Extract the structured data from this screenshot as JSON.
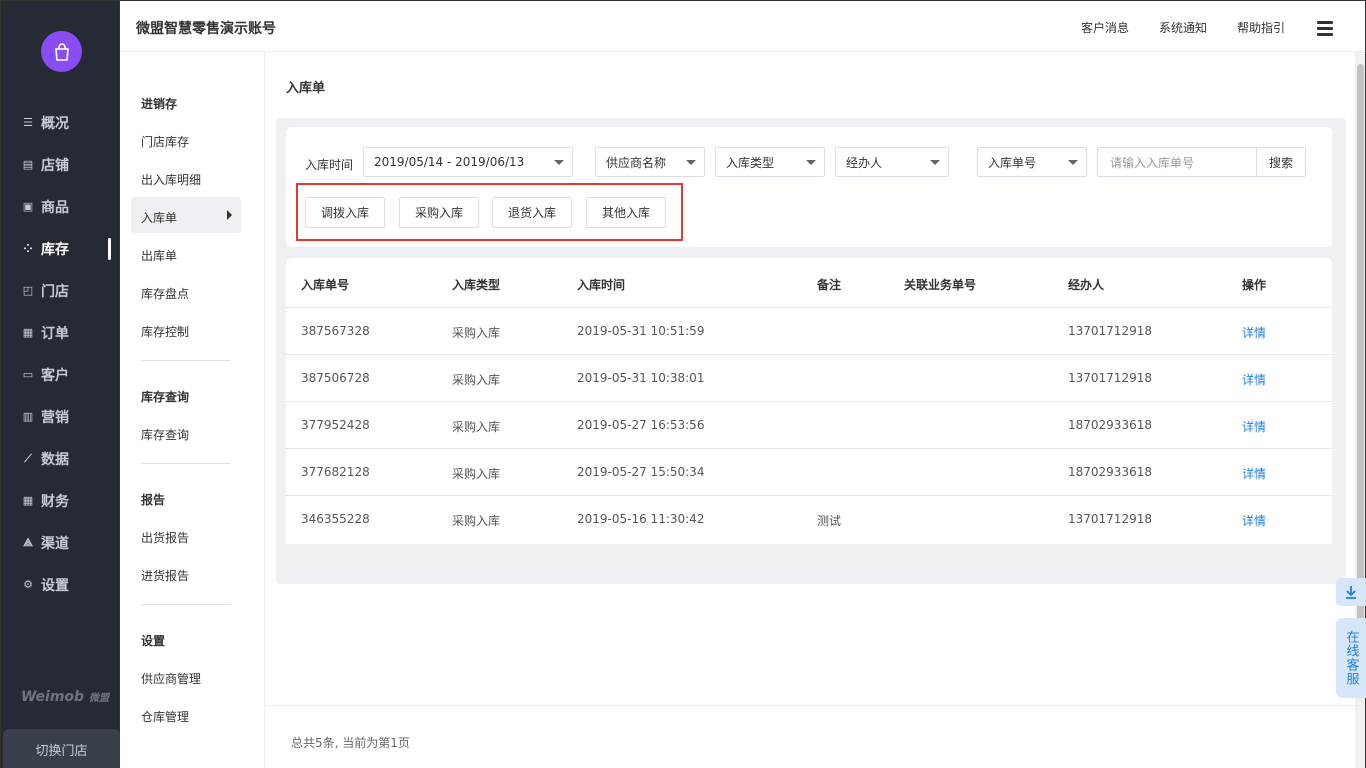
{
  "nav": {
    "items": [
      {
        "label": "概况",
        "icon": "list-icon"
      },
      {
        "label": "店铺",
        "icon": "store-icon"
      },
      {
        "label": "商品",
        "icon": "goods-icon"
      },
      {
        "label": "库存",
        "icon": "inventory-icon",
        "active": true
      },
      {
        "label": "门店",
        "icon": "shop-icon"
      },
      {
        "label": "订单",
        "icon": "order-icon"
      },
      {
        "label": "客户",
        "icon": "customer-icon"
      },
      {
        "label": "营销",
        "icon": "marketing-icon"
      },
      {
        "label": "数据",
        "icon": "data-icon"
      },
      {
        "label": "财务",
        "icon": "finance-icon"
      },
      {
        "label": "渠道",
        "icon": "channel-icon"
      },
      {
        "label": "设置",
        "icon": "settings-icon"
      }
    ],
    "brand": "Weimob",
    "brand_cn": "微盟",
    "switch_store": "切换门店"
  },
  "header": {
    "title": "微盟智慧零售演示账号",
    "links": [
      "客户消息",
      "系统通知",
      "帮助指引"
    ]
  },
  "subnav": {
    "sections": [
      {
        "title": "进销存",
        "items": [
          "门店库存",
          "出入库明细",
          "入库单",
          "出库单",
          "库存盘点",
          "库存控制"
        ]
      },
      {
        "title": "库存查询",
        "items": [
          "库存查询"
        ]
      },
      {
        "title": "报告",
        "items": [
          "出货报告",
          "进货报告"
        ]
      },
      {
        "title": "设置",
        "items": [
          "供应商管理",
          "仓库管理"
        ]
      }
    ],
    "active": "入库单"
  },
  "page": {
    "title": "入库单",
    "filters": {
      "time_label": "入库时间",
      "date_range": "2019/05/14 - 2019/06/13",
      "supplier": "供应商名称",
      "type": "入库类型",
      "operator": "经办人",
      "order_no_select": "入库单号",
      "search_placeholder": "请输入入库单号",
      "search_button": "搜索"
    },
    "type_buttons": [
      "调拨入库",
      "采购入库",
      "退货入库",
      "其他入库"
    ],
    "table": {
      "columns": [
        "入库单号",
        "入库类型",
        "入库时间",
        "备注",
        "关联业务单号",
        "经办人",
        "操作"
      ],
      "rows": [
        {
          "no": "387567328",
          "type": "采购入库",
          "time": "2019-05-31 10:51:59",
          "note": "",
          "ref": "",
          "operator": "13701712918",
          "action": "详情"
        },
        {
          "no": "387506728",
          "type": "采购入库",
          "time": "2019-05-31 10:38:01",
          "note": "",
          "ref": "",
          "operator": "13701712918",
          "action": "详情"
        },
        {
          "no": "377952428",
          "type": "采购入库",
          "time": "2019-05-27 16:53:56",
          "note": "",
          "ref": "",
          "operator": "18702933618",
          "action": "详情"
        },
        {
          "no": "377682128",
          "type": "采购入库",
          "time": "2019-05-27 15:50:34",
          "note": "",
          "ref": "",
          "operator": "18702933618",
          "action": "详情"
        },
        {
          "no": "346355228",
          "type": "采购入库",
          "time": "2019-05-16 11:30:42",
          "note": "测试",
          "ref": "",
          "operator": "13701712918",
          "action": "详情"
        }
      ]
    },
    "footer": "总共5条, 当前为第1页"
  },
  "floating": {
    "customer_service": "在线客服"
  },
  "colors": {
    "nav_bg": "#262a35",
    "logo": "#8a4cf3",
    "link": "#1e7fe6",
    "highlight_box": "#e53935"
  }
}
